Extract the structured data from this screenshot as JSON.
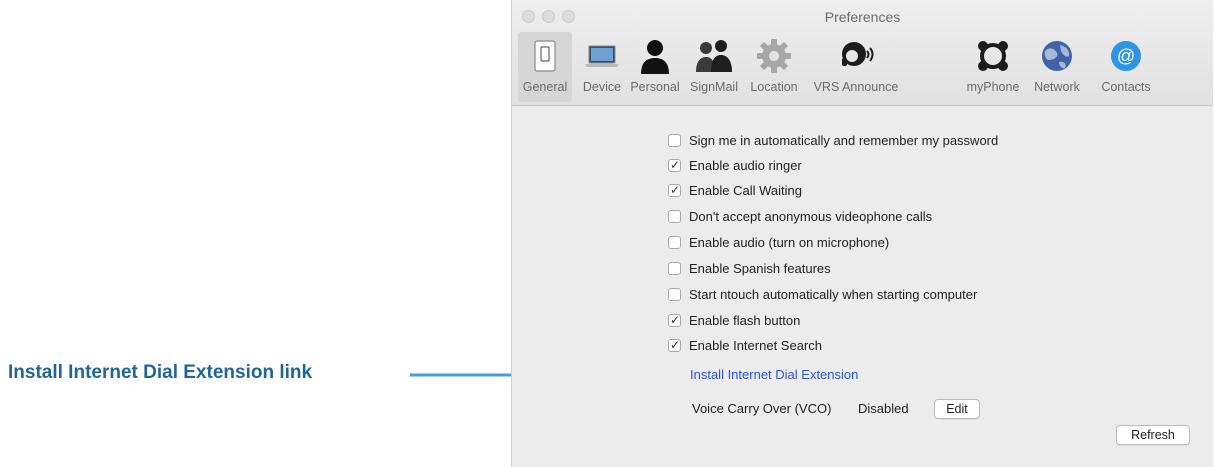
{
  "callout": {
    "label": "Install Internet Dial Extension link",
    "color": "#1f6596",
    "arrow_color": "#4a9bd9"
  },
  "window": {
    "title": "Preferences",
    "tabs": [
      {
        "label": "General",
        "icon": "switch-icon",
        "selected": true
      },
      {
        "label": "Device",
        "icon": "laptop-icon",
        "selected": false
      },
      {
        "label": "Personal",
        "icon": "person-icon",
        "selected": false
      },
      {
        "label": "SignMail",
        "icon": "people-icon",
        "selected": false
      },
      {
        "label": "Location",
        "icon": "gear-icon",
        "selected": false
      },
      {
        "label": "VRS Announce",
        "icon": "announcer-icon",
        "selected": false
      },
      {
        "label": "myPhone",
        "icon": "myphone-icon",
        "selected": false
      },
      {
        "label": "Network",
        "icon": "globe-icon",
        "selected": false
      },
      {
        "label": "Contacts",
        "icon": "at-sign-icon",
        "selected": false
      }
    ]
  },
  "options": [
    {
      "label": "Sign me in automatically and remember my password",
      "checked": false
    },
    {
      "label": "Enable audio ringer",
      "checked": true
    },
    {
      "label": "Enable Call Waiting",
      "checked": true
    },
    {
      "label": "Don't accept anonymous videophone calls",
      "checked": false
    },
    {
      "label": "Enable audio (turn on microphone)",
      "checked": false
    },
    {
      "label": "Enable Spanish features",
      "checked": false
    },
    {
      "label": "Start ntouch automatically when starting computer",
      "checked": false
    },
    {
      "label": "Enable flash button",
      "checked": true
    },
    {
      "label": "Enable Internet Search",
      "checked": true
    }
  ],
  "install_link": "Install Internet Dial Extension",
  "vco": {
    "label": "Voice Carry Over (VCO)",
    "status": "Disabled",
    "edit_label": "Edit"
  },
  "refresh_label": "Refresh",
  "tick_glyph": "✓"
}
